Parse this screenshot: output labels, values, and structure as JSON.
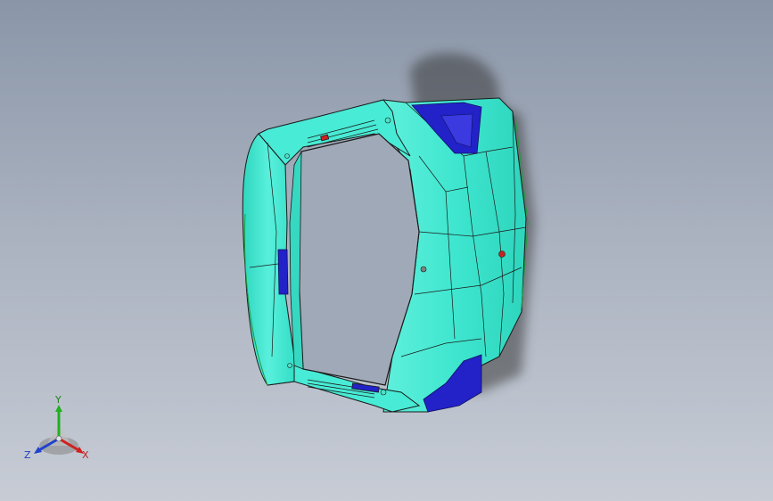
{
  "viewport": {
    "background_top": "#8a96a8",
    "background_bottom": "#c7ccd5"
  },
  "model": {
    "body_color": "#40e8d0",
    "edge_color": "#1a1a1a",
    "recess_color": "#2020c8",
    "marker_color": "#cc2020",
    "shadow_color": "#2a2a2a"
  },
  "triad": {
    "x_label": "X",
    "y_label": "Y",
    "z_label": "Z",
    "x_color": "#d02020",
    "y_color": "#20b020",
    "z_color": "#2040d0"
  }
}
